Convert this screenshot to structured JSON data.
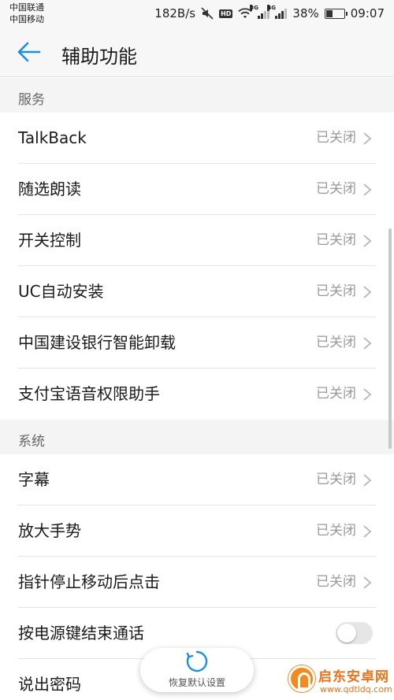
{
  "status_bar": {
    "carrier_1": "中国联通",
    "carrier_2": "中国移动",
    "net_speed": "182B/s",
    "hd_badge": "HD",
    "signal_1_tag": "3G",
    "signal_2_tag": "4G",
    "battery_percent": "38%",
    "battery_level": 0.38,
    "time": "09:07",
    "icons": [
      "mute-icon",
      "hd-icon",
      "wifi-icon",
      "signal-3g-icon",
      "signal-4g-icon",
      "battery-icon"
    ]
  },
  "app_bar": {
    "back_icon": "arrow-left-icon",
    "title": "辅助功能"
  },
  "sections": [
    {
      "header": "服务",
      "items": [
        {
          "label": "TalkBack",
          "status": "已关闭"
        },
        {
          "label": "随选朗读",
          "status": "已关闭"
        },
        {
          "label": "开关控制",
          "status": "已关闭"
        },
        {
          "label": "UC自动安装",
          "status": "已关闭"
        },
        {
          "label": "中国建设银行智能卸载",
          "status": "已关闭"
        },
        {
          "label": "支付宝语音权限助手",
          "status": "已关闭"
        }
      ]
    },
    {
      "header": "系统",
      "items": [
        {
          "label": "字幕",
          "status": "已关闭"
        },
        {
          "label": "放大手势",
          "status": "已关闭"
        },
        {
          "label": "指针停止移动后点击",
          "status": "已关闭"
        },
        {
          "label": "按电源键结束通话",
          "toggle": false
        },
        {
          "label": "说出密码"
        }
      ]
    }
  ],
  "restore_button": {
    "label": "恢复默认设置",
    "icon": "restore-icon"
  },
  "watermark": {
    "title": "启东安卓网",
    "url": "www.qdtldq.com"
  },
  "colors": {
    "accent": "#1a8fe3",
    "status_text": "#999999",
    "section_bg": "#f4f4f4",
    "toggle_off": "#e6e6e6",
    "watermark": "#e8731a"
  }
}
